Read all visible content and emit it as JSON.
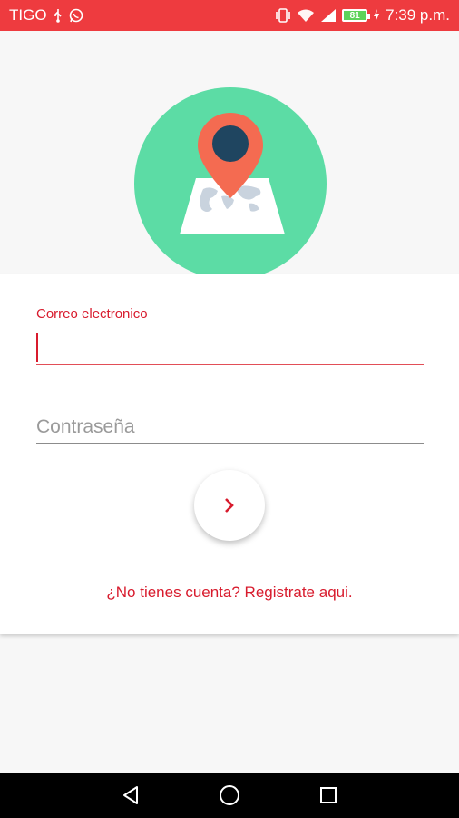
{
  "status_bar": {
    "carrier": "TIGO",
    "icons_left": [
      "usb-icon",
      "whatsapp-icon"
    ],
    "icons_right": [
      "vibrate-icon",
      "wifi-icon",
      "signal-icon",
      "battery-icon"
    ],
    "battery_level": "81",
    "time": "7:39 p.m.",
    "color": "#ee3b3f"
  },
  "logo": {
    "icon": "map-pin-icon",
    "circle_color": "#5cdca5",
    "pin_color": "#f46b51"
  },
  "login": {
    "email_label": "Correo electronico",
    "email_value": "",
    "password_placeholder": "Contraseña",
    "password_value": "",
    "submit_icon": "chevron-right-icon",
    "register_link": "¿No tienes cuenta? Registrate aqui.",
    "accent_color": "#d81b2d"
  },
  "nav_bar": {
    "buttons": [
      "back-icon",
      "home-icon",
      "recents-icon"
    ]
  }
}
